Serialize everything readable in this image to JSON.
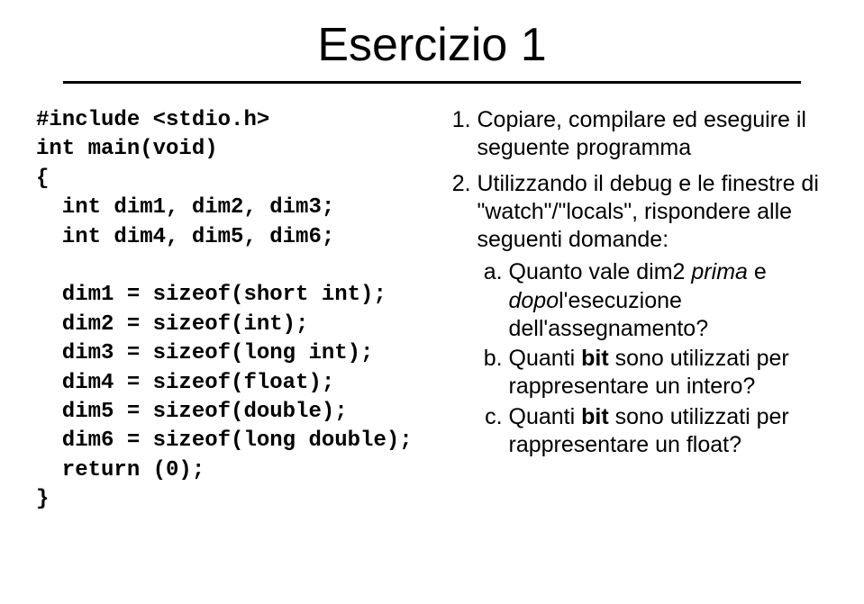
{
  "title": "Esercizio 1",
  "code": {
    "line1": "#include <stdio.h>",
    "line2": "int main(void)",
    "line3": "{",
    "line4": "  int dim1, dim2, dim3;",
    "line5": "  int dim4, dim5, dim6;",
    "blank1": "",
    "line6": "  dim1 = sizeof(short int);",
    "line7": "  dim2 = sizeof(int);",
    "line8": "  dim3 = sizeof(long int);",
    "line9": "  dim4 = sizeof(float);",
    "line10": "  dim5 = sizeof(double);",
    "line11": "  dim6 = sizeof(long double);",
    "line12": "  return (0);",
    "line13": "}"
  },
  "instructions": {
    "item1": "Copiare, compilare ed eseguire il seguente programma",
    "item2_part1": "Utilizzando il debug e le finestre di \"watch\"/\"locals\", rispondere alle seguenti domande:",
    "sub_a_part1": "Quanto vale dim2 ",
    "sub_a_prima": "prima",
    "sub_a_part2": " e ",
    "sub_a_dopo": "dopo",
    "sub_a_part3": "l'esecuzione dell'assegnamento?",
    "sub_b_part1": "Quanti ",
    "sub_b_bit": "bit",
    "sub_b_part2": " sono utilizzati per rappresentare un intero?",
    "sub_c_part1": "Quanti ",
    "sub_c_bit": "bit",
    "sub_c_part2": " sono utilizzati per rappresentare un float?"
  }
}
